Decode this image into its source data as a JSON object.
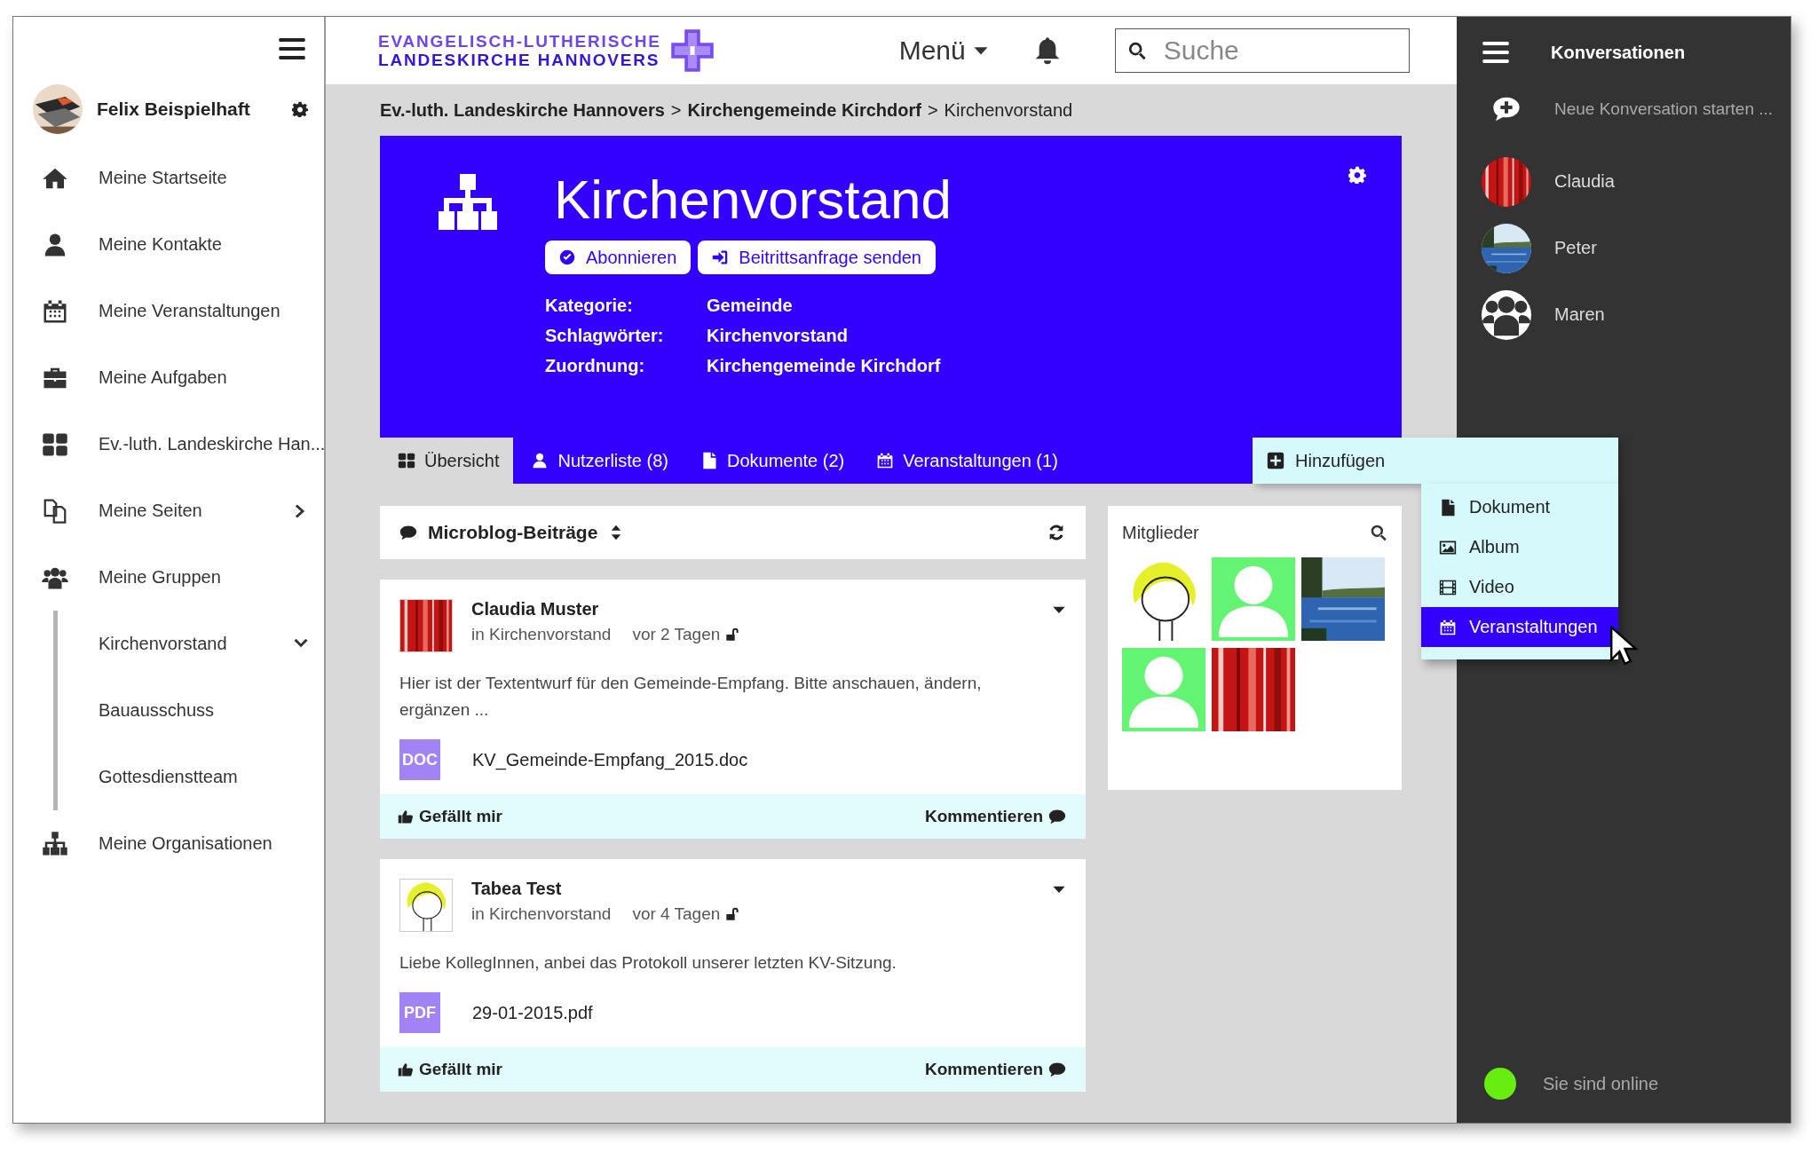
{
  "sidebar": {
    "user": {
      "name": "Felix Beispielhaft"
    },
    "items": [
      {
        "label": "Meine Startseite"
      },
      {
        "label": "Meine Kontakte"
      },
      {
        "label": "Meine Veranstaltungen"
      },
      {
        "label": "Meine Aufgaben"
      },
      {
        "label": "Ev.-luth. Landeskirche Han..."
      },
      {
        "label": "Meine Seiten",
        "expanded": false
      },
      {
        "label": "Meine Gruppen",
        "children": [
          {
            "label": "Kirchenvorstand",
            "expanded": true
          },
          {
            "label": "Bauausschuss"
          },
          {
            "label": "Gottesdienstteam"
          }
        ]
      },
      {
        "label": "Meine Organisationen"
      }
    ]
  },
  "header": {
    "logo": [
      "EVANGELISCH-LUTHERISCHE",
      "LANDESKIRCHE HANNOVERS"
    ],
    "menu": "Menü",
    "search": {
      "placeholder": "Suche"
    }
  },
  "breadcrumb": [
    {
      "kind": "link",
      "text": "Ev.-luth. Landeskirche Hannovers"
    },
    {
      "kind": "separator",
      "text": ">"
    },
    {
      "kind": "link",
      "text": "Kirchengemeinde Kirchdorf"
    },
    {
      "kind": "separator",
      "text": ">"
    },
    {
      "kind": "current",
      "text": "Kirchenvorstand"
    }
  ],
  "group": {
    "title": "Kirchenvorstand",
    "actions": [
      "Abonnieren",
      "Beitrittsanfrage senden"
    ],
    "info": [
      {
        "label": "Kategorie:",
        "value": "Gemeinde"
      },
      {
        "label": "Schlagwörter:",
        "value": "Kirchenvorstand"
      },
      {
        "label": "Zuordnung:",
        "value": "Kirchengemeinde Kirchdorf"
      }
    ]
  },
  "tabs": [
    {
      "label": "Übersicht",
      "selected": true
    },
    {
      "label": "Nutzerliste (8)",
      "selected": false
    },
    {
      "label": "Dokumente (2)",
      "selected": false
    },
    {
      "label": "Veranstaltungen (1)",
      "selected": false
    }
  ],
  "add_menu": {
    "label": "Hinzufügen",
    "expanded": true,
    "items": [
      {
        "label": "Dokument",
        "selected": false
      },
      {
        "label": "Album",
        "selected": false
      },
      {
        "label": "Video",
        "selected": false
      },
      {
        "label": "Veranstaltungen",
        "selected": true
      }
    ]
  },
  "feed": {
    "title": "Microblog-Beiträge",
    "posts": [
      {
        "author": "Claudia Muster",
        "group": "in Kirchenvorstand",
        "time": "vor 2 Tagen",
        "text": "Hier ist der Textentwurf für den Gemeinde-Empfang. Bitte anschauen, ändern, ergänzen ...",
        "attachment": {
          "type": "DOC",
          "name": "KV_Gemeinde-Empfang_2015.doc"
        },
        "like": "Gefällt mir",
        "comment": "Kommentieren"
      },
      {
        "author": "Tabea Test",
        "group": "in Kirchenvorstand",
        "time": "vor 4 Tagen",
        "text": "Liebe KollegInnen, anbei das Protokoll unserer letzten KV-Sitzung.",
        "attachment": {
          "type": "PDF",
          "name": "29-01-2015.pdf"
        },
        "like": "Gefällt mir",
        "comment": "Kommentieren"
      }
    ]
  },
  "members": {
    "title": "Mitglieder",
    "items": [
      {
        "kind": "picture"
      },
      {
        "kind": "placeholder"
      },
      {
        "kind": "picture"
      },
      {
        "kind": "placeholder"
      },
      {
        "kind": "picture"
      }
    ]
  },
  "conversations": {
    "title": "Konversationen",
    "new": "Neue Konversation starten ...",
    "items": [
      {
        "name": "Claudia",
        "kind": "picture"
      },
      {
        "name": "Peter",
        "kind": "picture"
      },
      {
        "name": "Maren",
        "kind": "group"
      }
    ],
    "status": {
      "label": "Sie sind online",
      "online": true
    }
  }
}
